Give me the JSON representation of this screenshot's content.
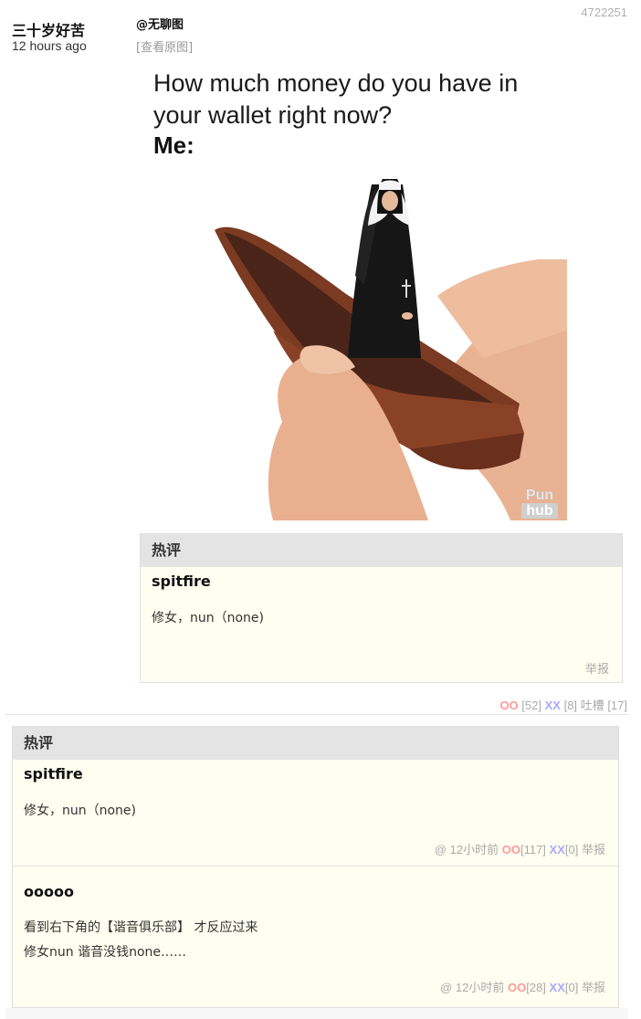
{
  "post": {
    "id": "4722251",
    "author": "三十岁好苦",
    "time": "12 hours ago",
    "source": "@无聊图",
    "view_original": "[查看原图]"
  },
  "meme": {
    "line1": "How much money do you have in",
    "line2": "your wallet right now?",
    "line3": "Me:",
    "watermark_top": "Pun",
    "watermark_bottom": "hub"
  },
  "hot_top": {
    "header": "热评",
    "user": "spitfire",
    "text": "修女，nun（none)",
    "report": "举报"
  },
  "votes": {
    "oo_label": "OO",
    "oo_count": "[52]",
    "xx_label": "XX",
    "xx_count": "[8]",
    "tucao_label": "吐槽",
    "tucao_count": "[17]"
  },
  "hot_list": {
    "header": "热评",
    "comments": [
      {
        "user": "spitfire",
        "line1": "修女，nun（none)",
        "line2": "",
        "at": "@",
        "time": "12小时前",
        "oo_label": "OO",
        "oo_count": "[117]",
        "xx_label": "XX",
        "xx_count": "[0]",
        "report": "举报"
      },
      {
        "user": "ooooo",
        "line1": "看到右下角的【谐音俱乐部】 才反应过来",
        "line2": "修女nun 谐音没钱none……",
        "at": "@",
        "time": "12小时前",
        "oo_label": "OO",
        "oo_count": "[28]",
        "xx_label": "XX",
        "xx_count": "[0]",
        "report": "举报"
      }
    ]
  },
  "colors": {
    "oo": "#ff9a9a",
    "xx": "#a9a9ff",
    "comment_bg": "#fefff0",
    "header_bg": "#e4e4e4"
  }
}
